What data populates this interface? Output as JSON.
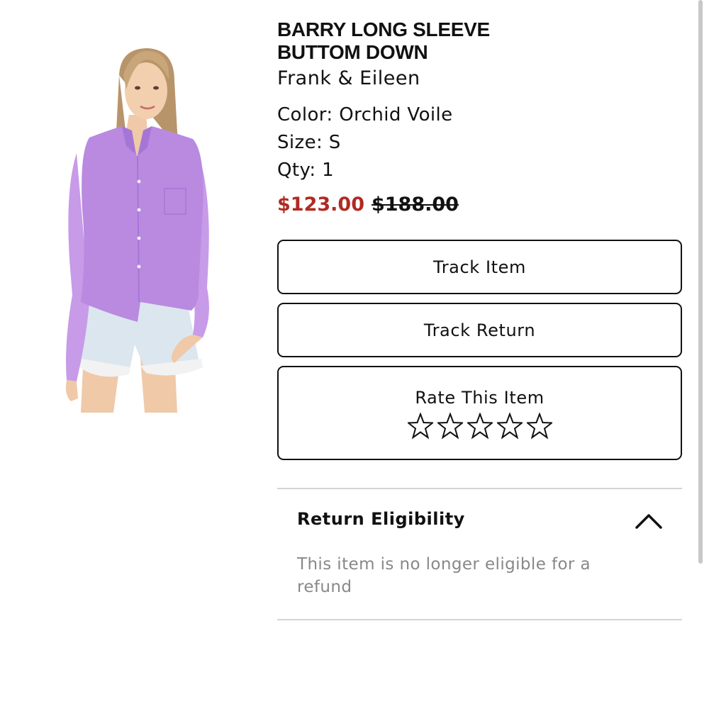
{
  "product": {
    "title": "BARRY LONG SLEEVE BUTTOM DOWN",
    "brand": "Frank & Eileen",
    "color_line": "Color: Orchid Voile",
    "size_line": "Size: S",
    "qty_line": "Qty: 1",
    "sale_price": "$123.00",
    "original_price": "$188.00",
    "image_icon": "product-photo"
  },
  "actions": {
    "track_item": "Track Item",
    "track_return": "Track Return",
    "rate_label": "Rate This Item",
    "rating": {
      "value": 0,
      "max": 5
    }
  },
  "return_eligibility": {
    "title": "Return Eligibility",
    "message": "This item is no longer eligible for a refund",
    "expanded": true,
    "toggle_icon": "chevron-up-icon"
  },
  "colors": {
    "sale_price": "#b12a22",
    "text": "#111111",
    "muted_text": "#888888",
    "divider": "#d4d4d4",
    "shirt": "#b98ae0"
  }
}
